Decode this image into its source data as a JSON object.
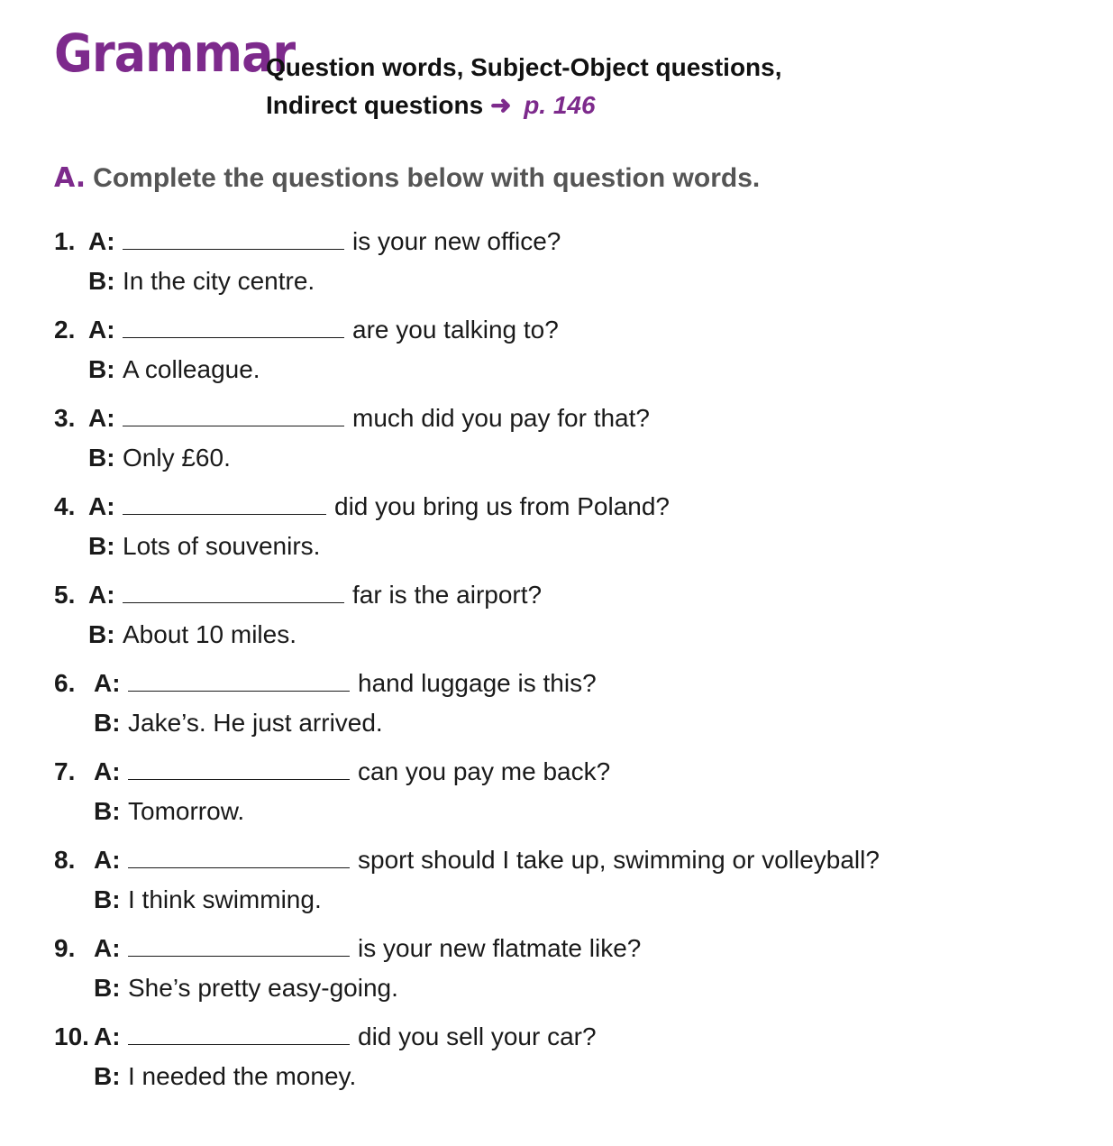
{
  "colors": {
    "accent": "#7d2a8c",
    "instruction": "#555555",
    "text": "#1a1a1a"
  },
  "header": {
    "brand": "Grammar",
    "subtitle_line1": "Question words, Subject-Object questions,",
    "subtitle_line2": "Indirect questions",
    "arrow": "➜",
    "page_ref": "p. 146"
  },
  "exercise": {
    "letter": "A.",
    "instruction": "Complete the questions below with question words."
  },
  "items": [
    {
      "number": "1.",
      "a_label": "A:",
      "a_text": "is your new office?",
      "b_label": "B:",
      "b_text": "In the city centre."
    },
    {
      "number": "2.",
      "a_label": "A:",
      "a_text": "are you talking to?",
      "b_label": "B:",
      "b_text": "A colleague."
    },
    {
      "number": "3.",
      "a_label": "A:",
      "a_text": "much did you pay for that?",
      "b_label": "B:",
      "b_text": "Only £60."
    },
    {
      "number": "4.",
      "a_label": "A:",
      "a_text": "did you bring us from Poland?",
      "b_label": "B:",
      "b_text": "Lots of souvenirs."
    },
    {
      "number": "5.",
      "a_label": "A:",
      "a_text": "far is the airport?",
      "b_label": "B:",
      "b_text": "About 10 miles."
    },
    {
      "number": "6.",
      "a_label": "A:",
      "a_text": "hand luggage is this?",
      "b_label": "B:",
      "b_text": "Jake’s. He just arrived."
    },
    {
      "number": "7.",
      "a_label": "A:",
      "a_text": "can you pay me back?",
      "b_label": "B:",
      "b_text": "Tomorrow."
    },
    {
      "number": "8.",
      "a_label": "A:",
      "a_text": "sport should I take up, swimming or volleyball?",
      "b_label": "B:",
      "b_text": "I think swimming."
    },
    {
      "number": "9.",
      "a_label": "A:",
      "a_text": "is your new flatmate like?",
      "b_label": "B:",
      "b_text": "She’s pretty easy-going."
    },
    {
      "number": "10.",
      "a_label": "A:",
      "a_text": "did you sell your car?",
      "b_label": "B:",
      "b_text": "I needed the money."
    }
  ]
}
